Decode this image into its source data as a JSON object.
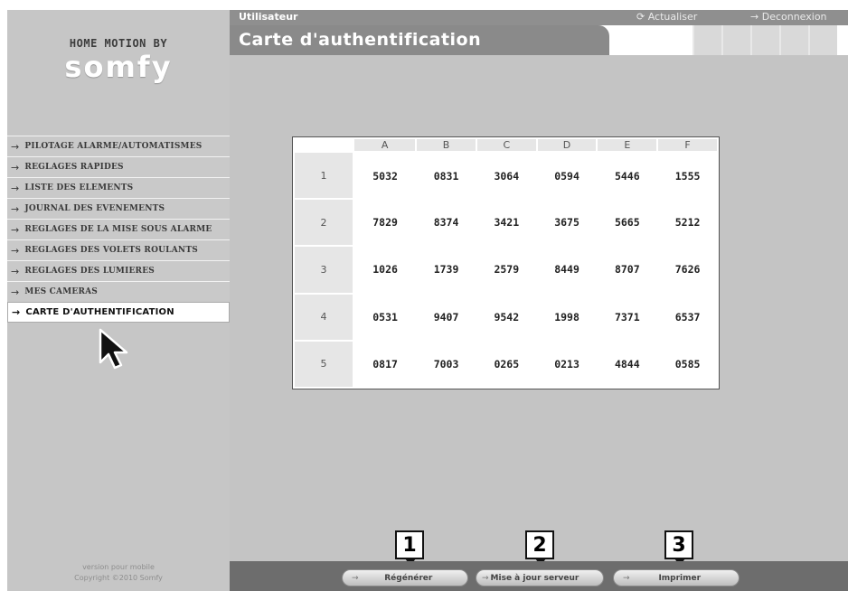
{
  "brand": {
    "tagline": "HOME MOTION BY",
    "logo": "somfy"
  },
  "topbar": {
    "section": "Utilisateur",
    "refresh": "Actualiser",
    "logout": "Deconnexion"
  },
  "page": {
    "title": "Carte d'authentification"
  },
  "sidebar": {
    "items": [
      {
        "label": "PILOTAGE ALARME/AUTOMATISMES"
      },
      {
        "label": "REGLAGES RAPIDES"
      },
      {
        "label": "LISTE DES ELEMENTS"
      },
      {
        "label": "JOURNAL DES EVENEMENTS"
      },
      {
        "label": "REGLAGES DE LA MISE SOUS ALARME"
      },
      {
        "label": "REGLAGES DES VOLETS ROULANTS"
      },
      {
        "label": "REGLAGES DES LUMIERES"
      },
      {
        "label": "MES CAMERAS"
      },
      {
        "label": "CARTE D'AUTHENTIFICATION"
      }
    ],
    "footer_line1": "version pour mobile",
    "footer_line2": "Copyright ©2010 Somfy"
  },
  "card": {
    "columns": [
      "A",
      "B",
      "C",
      "D",
      "E",
      "F"
    ],
    "rows": [
      {
        "label": "1",
        "codes": [
          "5032",
          "0831",
          "3064",
          "0594",
          "5446",
          "1555"
        ]
      },
      {
        "label": "2",
        "codes": [
          "7829",
          "8374",
          "3421",
          "3675",
          "5665",
          "5212"
        ]
      },
      {
        "label": "3",
        "codes": [
          "1026",
          "1739",
          "2579",
          "8449",
          "8707",
          "7626"
        ]
      },
      {
        "label": "4",
        "codes": [
          "0531",
          "9407",
          "9542",
          "1998",
          "7371",
          "6537"
        ]
      },
      {
        "label": "5",
        "codes": [
          "0817",
          "7003",
          "0265",
          "0213",
          "4844",
          "0585"
        ]
      }
    ]
  },
  "actions": {
    "regenerate": "Régénérer",
    "update_server": "Mise à jour serveur",
    "print": "Imprimer"
  },
  "callouts": [
    "1",
    "2",
    "3"
  ]
}
